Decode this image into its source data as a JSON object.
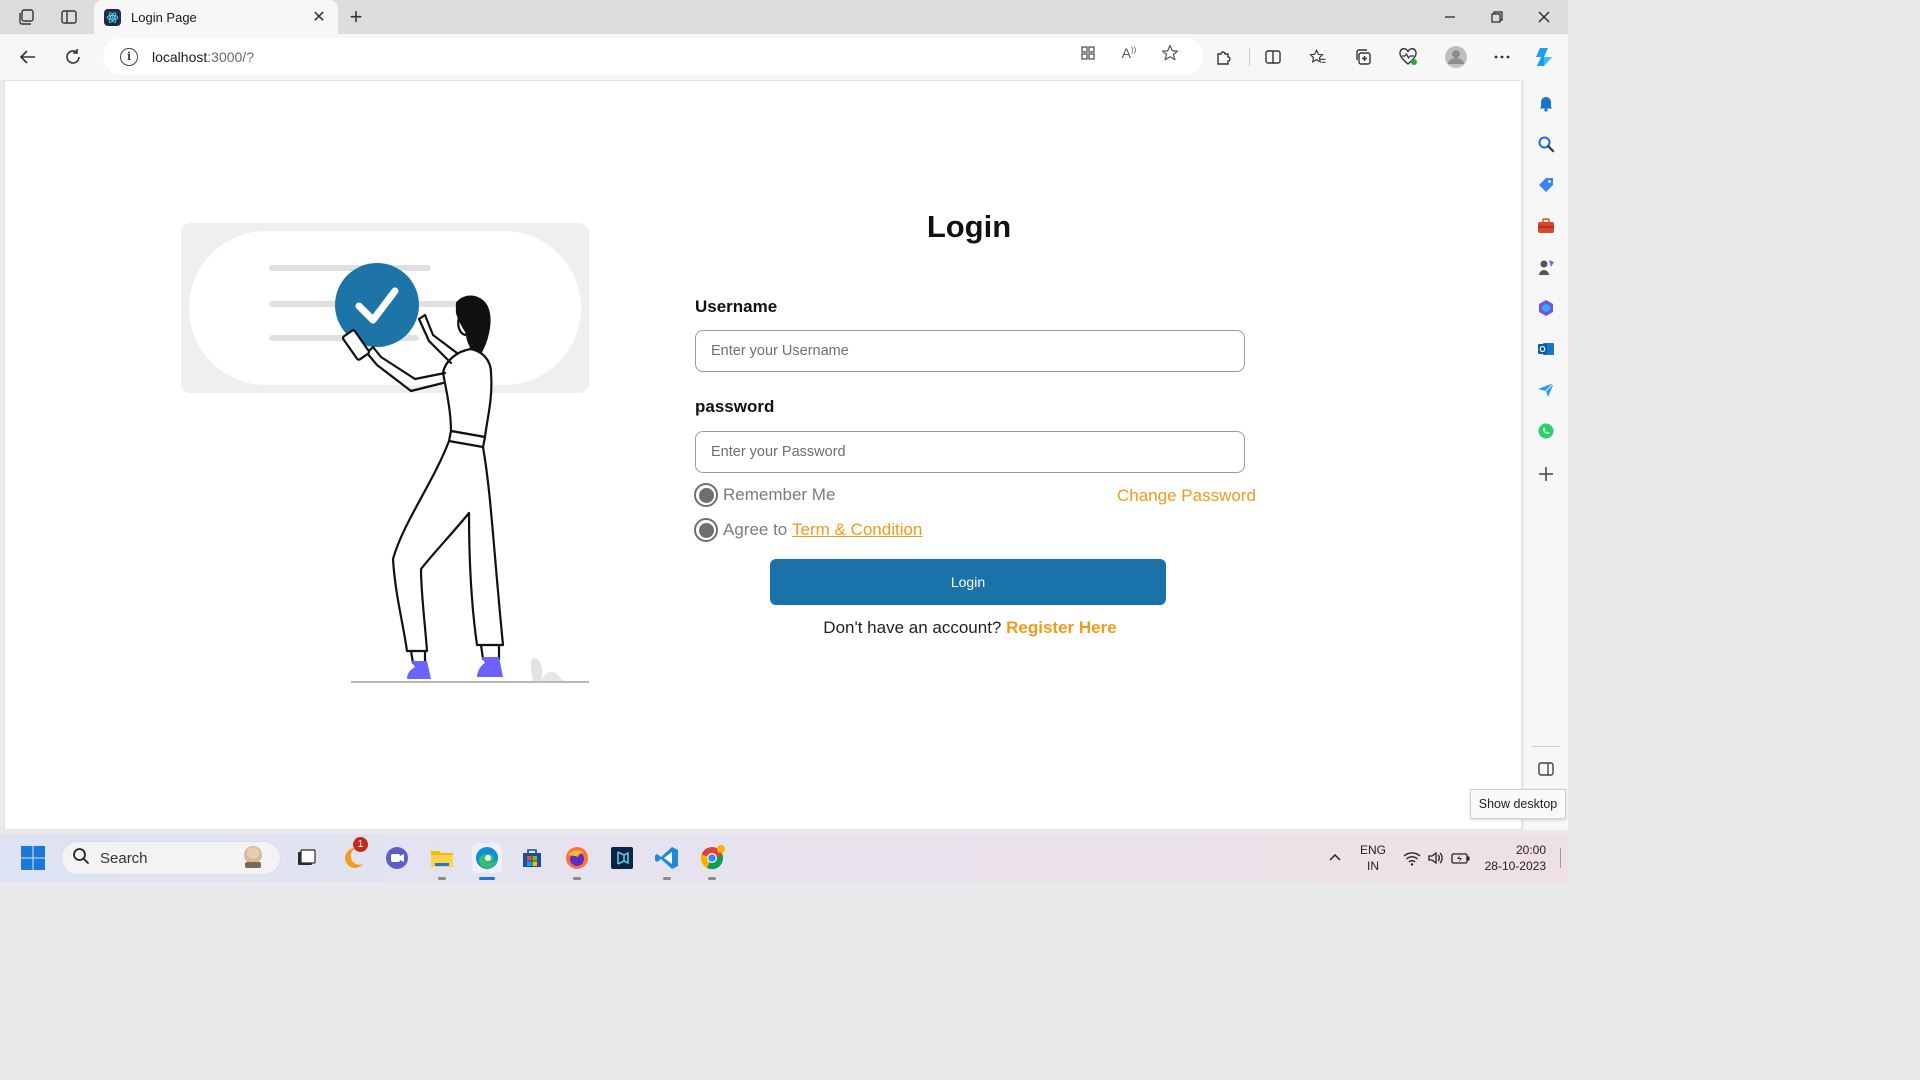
{
  "browser": {
    "tab_title": "Login Page",
    "url_host": "localhost",
    "url_path": ":3000/?"
  },
  "page": {
    "title": "Login",
    "username_label": "Username",
    "username_placeholder": "Enter your Username",
    "password_label": "password",
    "password_placeholder": "Enter your Password",
    "remember_label": "Remember Me",
    "change_password": "Change Password",
    "agree_prefix": "Agree to",
    "terms_link": "Term & Condition",
    "login_button": "Login",
    "no_account": "Don't have an account?",
    "register_link": "Register Here"
  },
  "tooltip": "Show desktop",
  "taskbar": {
    "search_label": "Search",
    "notification_badge": "1",
    "lang_top": "ENG",
    "lang_bottom": "IN",
    "time": "20:00",
    "date": "28-10-2023"
  },
  "colors": {
    "primary_button": "#1a73a8",
    "accent_orange": "#f29a1a",
    "check_circle": "#1d74a7",
    "shoes": "#6c63ff"
  }
}
